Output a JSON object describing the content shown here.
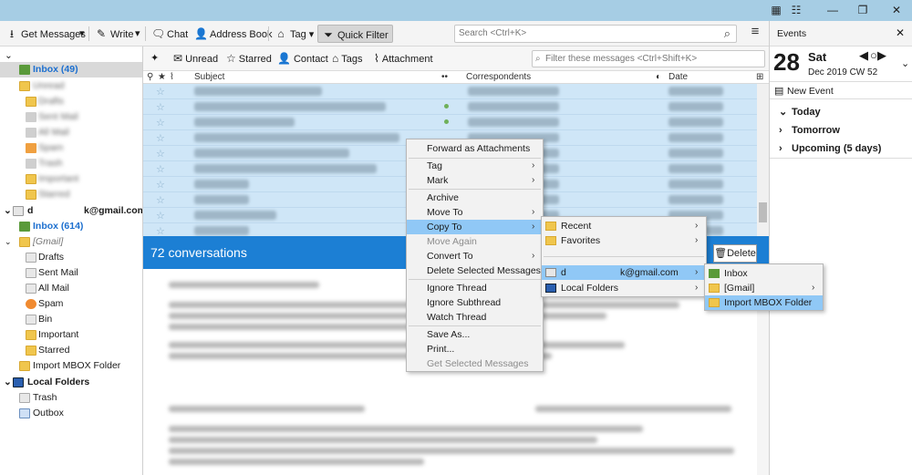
{
  "toolbar": {
    "get_messages": "Get Messages",
    "write": "Write",
    "chat": "Chat",
    "address_book": "Address Book",
    "tag": "Tag",
    "quick_filter": "Quick Filter",
    "search_placeholder": "Search <Ctrl+K>"
  },
  "folders": {
    "inbox_top": "Inbox (49)",
    "blurred_items": [
      "Unread",
      "Drafts",
      "Sent Mail",
      "All Mail",
      "Spam",
      "Trash",
      "Important",
      "Starred"
    ],
    "account_prefix": "d",
    "account_suffix": "k@gmail.com",
    "inbox_account": "Inbox (614)",
    "gmail": "[Gmail]",
    "drafts": "Drafts",
    "sent_mail": "Sent Mail",
    "all_mail": "All Mail",
    "spam": "Spam",
    "bin": "Bin",
    "important": "Important",
    "starred": "Starred",
    "import_mbox": "Import MBOX Folder",
    "local_folders": "Local Folders",
    "trash": "Trash",
    "outbox": "Outbox"
  },
  "quickfilter": {
    "unread": "Unread",
    "starred": "Starred",
    "contact": "Contact",
    "tags": "Tags",
    "attachment": "Attachment",
    "filter_placeholder": "Filter these messages <Ctrl+Shift+K>"
  },
  "columns": {
    "subject": "Subject",
    "correspondents": "Correspondents",
    "date": "Date"
  },
  "conversation": {
    "count_text": "72 conversations",
    "delete": "Delete"
  },
  "events": {
    "title": "Events",
    "day_number": "28",
    "weekday": "Sat",
    "month_info": "Dec 2019  CW 52",
    "new_event": "New Event",
    "today": "Today",
    "tomorrow": "Tomorrow",
    "upcoming": "Upcoming (5 days)"
  },
  "context_menu": {
    "forward_attachments": "Forward as Attachments",
    "tag": "Tag",
    "mark": "Mark",
    "archive": "Archive",
    "move_to": "Move To",
    "copy_to": "Copy To",
    "move_again": "Move Again",
    "convert_to": "Convert To",
    "delete_selected": "Delete Selected Messages",
    "ignore_thread": "Ignore Thread",
    "ignore_subthread": "Ignore Subthread",
    "watch_thread": "Watch Thread",
    "save_as": "Save As...",
    "print": "Print...",
    "get_selected": "Get Selected Messages"
  },
  "copy_submenu": {
    "recent": "Recent",
    "favorites": "Favorites",
    "account_prefix": "d",
    "account_suffix": "k@gmail.com",
    "local_folders": "Local Folders"
  },
  "account_submenu": {
    "inbox": "Inbox",
    "gmail": "[Gmail]",
    "import_mbox": "Import MBOX Folder"
  },
  "colors": {
    "titlebar": "#a6cde4",
    "selection": "#cfe6f7",
    "conversation_bar": "#1c7fd4",
    "menu_highlight": "#90c8f6"
  }
}
